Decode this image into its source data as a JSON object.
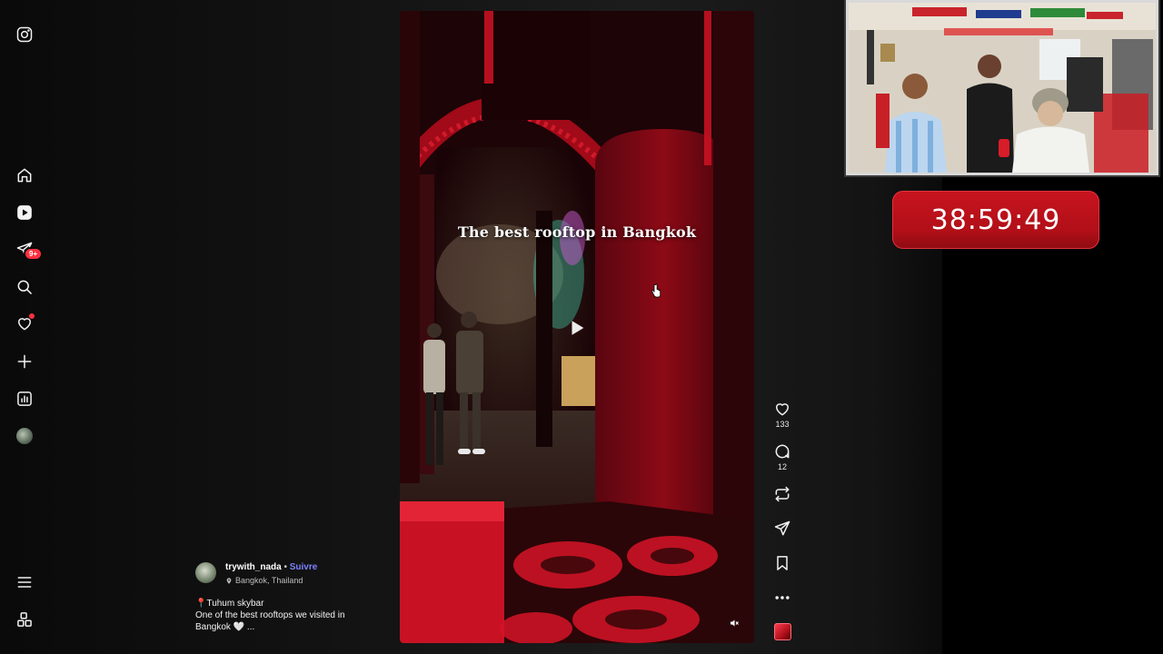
{
  "nav": {
    "items": [
      {
        "icon": "instagram-icon",
        "label": "Instagram"
      },
      {
        "icon": "home-icon",
        "label": "Home"
      },
      {
        "icon": "reels-icon",
        "label": "Reels"
      },
      {
        "icon": "messages-icon",
        "label": "Messages",
        "badge": "9+"
      },
      {
        "icon": "search-icon",
        "label": "Search"
      },
      {
        "icon": "heart-icon",
        "label": "Notifications"
      },
      {
        "icon": "plus-icon",
        "label": "Create"
      },
      {
        "icon": "insights-icon",
        "label": "Insights"
      },
      {
        "icon": "profile-avatar",
        "label": "Profile"
      },
      {
        "icon": "menu-icon",
        "label": "More"
      },
      {
        "icon": "apps-icon",
        "label": "Also from Meta"
      }
    ],
    "messages_badge": "9+"
  },
  "reel": {
    "overlay_title": "The best rooftop in Bangkok"
  },
  "actions": {
    "likes": "133",
    "comments": "12"
  },
  "author": {
    "username": "trywith_nada",
    "separator": " • ",
    "follow_label": "Suivre",
    "location": "Bangkok, Thailand"
  },
  "caption": {
    "line1": "📍Tuhum skybar",
    "line2": "One of the best rooftops we visited in Bangkok 🤍 ..."
  },
  "stream": {
    "timer": "38:59:49"
  },
  "colors": {
    "accent_follow": "#7c83ff",
    "badge_red": "#ff3040",
    "timer_red": "#c8141f"
  }
}
